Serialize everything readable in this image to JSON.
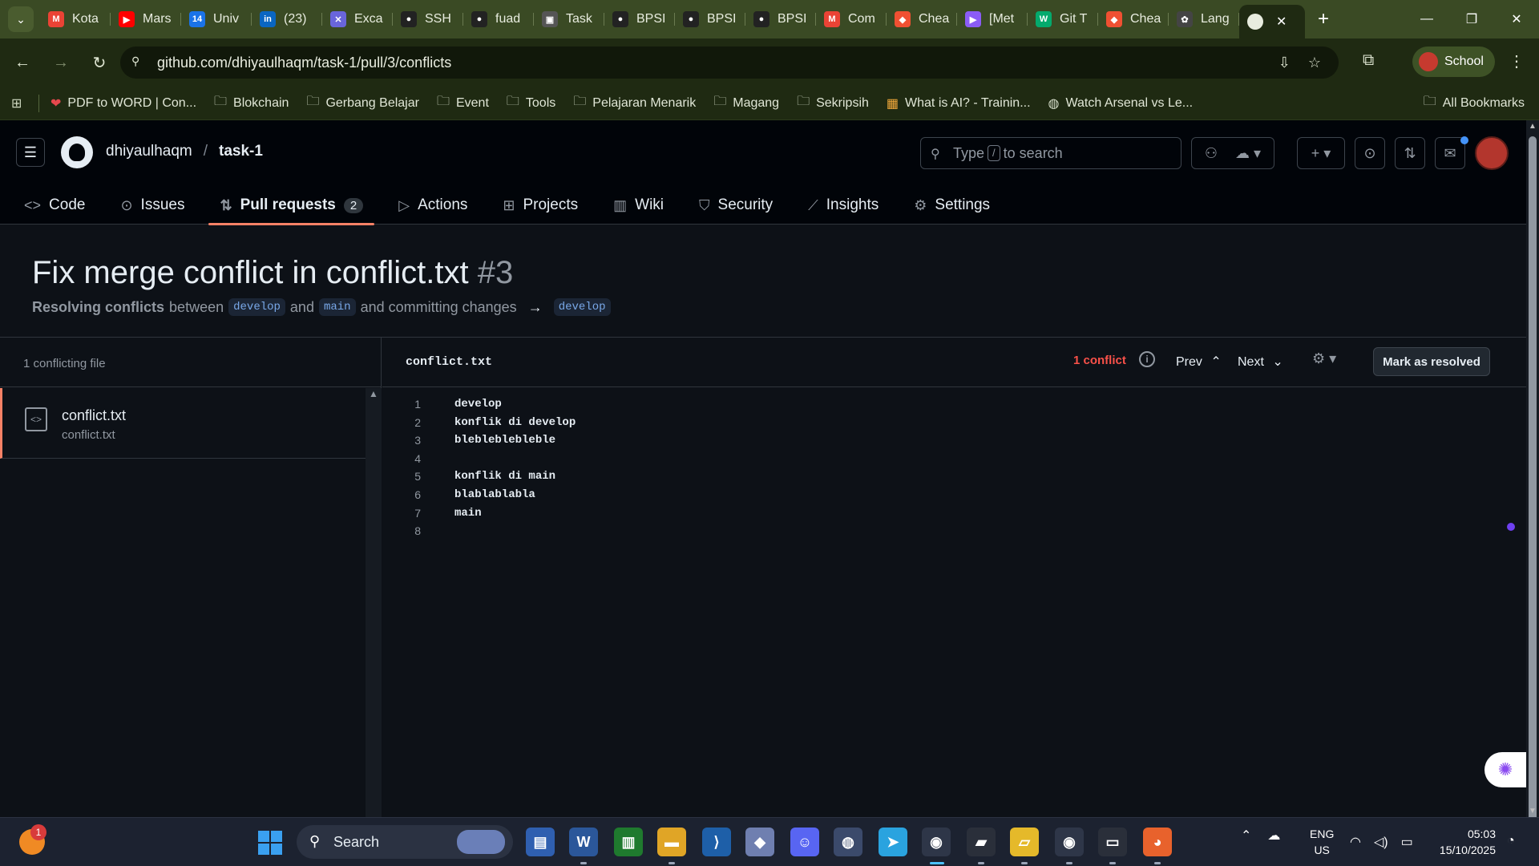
{
  "browser": {
    "tabs": [
      {
        "label": "Kota",
        "icon": "gmail-icon",
        "color": "#ea4335",
        "glyph": "M"
      },
      {
        "label": "Mars",
        "icon": "youtube-icon",
        "color": "#ff0000",
        "glyph": "▶"
      },
      {
        "label": "Univ",
        "icon": "calendar-icon",
        "color": "#1a73e8",
        "glyph": "14"
      },
      {
        "label": "(23)",
        "icon": "linkedin-icon",
        "color": "#0a66c2",
        "glyph": "in"
      },
      {
        "label": "Exca",
        "icon": "excalidraw-icon",
        "color": "#6965db",
        "glyph": "✕"
      },
      {
        "label": "SSH",
        "icon": "github-icon",
        "color": "#222222",
        "glyph": "●"
      },
      {
        "label": "fuad",
        "icon": "github-icon",
        "color": "#222222",
        "glyph": "●"
      },
      {
        "label": "Task",
        "icon": "classroom-icon",
        "color": "#555555",
        "glyph": "▣"
      },
      {
        "label": "BPSI",
        "icon": "github-icon",
        "color": "#222222",
        "glyph": "●"
      },
      {
        "label": "BPSI",
        "icon": "github-icon",
        "color": "#222222",
        "glyph": "●"
      },
      {
        "label": "BPSI",
        "icon": "github-icon",
        "color": "#222222",
        "glyph": "●"
      },
      {
        "label": "Com",
        "icon": "gmail-icon",
        "color": "#ea4335",
        "glyph": "M"
      },
      {
        "label": "Chea",
        "icon": "git-icon",
        "color": "#f05032",
        "glyph": "◆"
      },
      {
        "label": "[Met",
        "icon": "video-icon",
        "color": "#8b5cf6",
        "glyph": "▶"
      },
      {
        "label": "Git T",
        "icon": "w3-icon",
        "color": "#04aa6d",
        "glyph": "W"
      },
      {
        "label": "Chea",
        "icon": "git-icon",
        "color": "#f05032",
        "glyph": "◆"
      },
      {
        "label": "Lang",
        "icon": "openai-icon",
        "color": "#444444",
        "glyph": "✿"
      }
    ],
    "url": "github.com/dhiyaulhaqm/task-1/pull/3/conflicts",
    "profile_label": "School",
    "bookmarks": [
      {
        "label": "PDF to WORD | Con...",
        "icon": "heart-icon"
      },
      {
        "label": "Blokchain",
        "icon": "folder-icon"
      },
      {
        "label": "Gerbang Belajar",
        "icon": "folder-icon"
      },
      {
        "label": "Event",
        "icon": "folder-icon"
      },
      {
        "label": "Tools",
        "icon": "folder-icon"
      },
      {
        "label": "Pelajaran Menarik",
        "icon": "folder-icon"
      },
      {
        "label": "Magang",
        "icon": "folder-icon"
      },
      {
        "label": "Sekripsih",
        "icon": "folder-icon"
      },
      {
        "label": "What is AI? - Trainin...",
        "icon": "microsoft-icon"
      },
      {
        "label": "Watch Arsenal vs Le...",
        "icon": "globe-icon"
      }
    ],
    "all_bookmarks_label": "All Bookmarks"
  },
  "github": {
    "owner": "dhiyaulhaqm",
    "repo": "task-1",
    "search_pre": "Type",
    "search_key": "/",
    "search_post": "to search",
    "nav": [
      {
        "label": "Code",
        "icon": "code-icon",
        "glyph": "<>"
      },
      {
        "label": "Issues",
        "icon": "issue-icon",
        "glyph": "⊙"
      },
      {
        "label": "Pull requests",
        "icon": "pull-request-icon",
        "glyph": "⇅",
        "count": "2",
        "active": true
      },
      {
        "label": "Actions",
        "icon": "play-icon",
        "glyph": "▷"
      },
      {
        "label": "Projects",
        "icon": "table-icon",
        "glyph": "⊞"
      },
      {
        "label": "Wiki",
        "icon": "book-icon",
        "glyph": "▥"
      },
      {
        "label": "Security",
        "icon": "shield-icon",
        "glyph": "⛉"
      },
      {
        "label": "Insights",
        "icon": "graph-icon",
        "glyph": "⟋"
      },
      {
        "label": "Settings",
        "icon": "gear-icon",
        "glyph": "⚙"
      }
    ]
  },
  "pr": {
    "title": "Fix merge conflict in conflict.txt",
    "number": "#3",
    "sub_bold": "Resolving conflicts",
    "sub_between": "between",
    "branch_a": "develop",
    "sub_and": "and",
    "branch_b": "main",
    "sub_commit": "and committing changes",
    "arrow": "→",
    "branch_target": "develop"
  },
  "conflicts": {
    "count_label": "1 conflicting file",
    "file_name": "conflict.txt",
    "file_path": "conflict.txt",
    "editor_file": "conflict.txt",
    "conflict_count": "1 conflict",
    "prev_label": "Prev",
    "next_label": "Next",
    "mark_resolved_label": "Mark as resolved",
    "lines": [
      {
        "n": "1",
        "text": "develop"
      },
      {
        "n": "2",
        "text": "konflik di develop"
      },
      {
        "n": "3",
        "text": "blebleblebleble"
      },
      {
        "n": "4",
        "text": ""
      },
      {
        "n": "5",
        "text": "konflik di main"
      },
      {
        "n": "6",
        "text": "blablablabla"
      },
      {
        "n": "7",
        "text": "main"
      },
      {
        "n": "8",
        "text": ""
      }
    ]
  },
  "taskbar": {
    "weather_badge": "1",
    "search_label": "Search",
    "lang_top": "ENG",
    "lang_bottom": "US",
    "time": "05:03",
    "date": "15/10/2025"
  }
}
